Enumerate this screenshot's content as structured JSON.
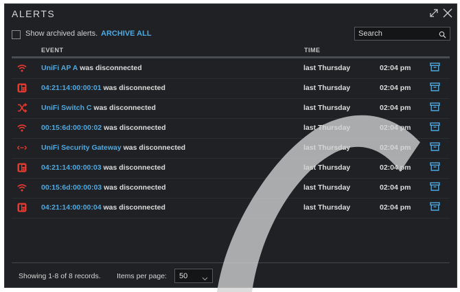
{
  "window": {
    "title": "ALERTS"
  },
  "toolbar": {
    "show_archived_label": "Show archived alerts.",
    "archive_all_label": "ARCHIVE ALL",
    "search_placeholder": "Search"
  },
  "columns": {
    "event": "EVENT",
    "time": "TIME"
  },
  "alerts": [
    {
      "icon": "wifi-icon",
      "device": "UniFi AP A",
      "text": "was disconnected",
      "day": "last Thursday",
      "time": "02:04 pm"
    },
    {
      "icon": "phone-icon",
      "device": "04:21:14:00:00:01",
      "text": "was disconnected",
      "day": "last Thursday",
      "time": "02:04 pm"
    },
    {
      "icon": "switch-icon",
      "device": "UniFi Switch C",
      "text": "was disconnected",
      "day": "last Thursday",
      "time": "02:04 pm"
    },
    {
      "icon": "wifi-icon",
      "device": "00:15:6d:00:00:02",
      "text": "was disconnected",
      "day": "last Thursday",
      "time": "02:04 pm"
    },
    {
      "icon": "gateway-icon",
      "device": "UniFi Security Gateway",
      "text": "was disconnected",
      "day": "last Thursday",
      "time": "02:04 pm"
    },
    {
      "icon": "phone-icon",
      "device": "04:21:14:00:00:03",
      "text": "was disconnected",
      "day": "last Thursday",
      "time": "02:04 pm"
    },
    {
      "icon": "wifi-icon",
      "device": "00:15:6d:00:00:03",
      "text": "was disconnected",
      "day": "last Thursday",
      "time": "02:04 pm"
    },
    {
      "icon": "phone-icon",
      "device": "04:21:14:00:00:04",
      "text": "was disconnected",
      "day": "last Thursday",
      "time": "02:04 pm"
    }
  ],
  "footer": {
    "showing_text": "Showing 1-8 of 8 records.",
    "items_per_page_label": "Items per page:",
    "items_per_page_value": "50"
  },
  "colors": {
    "accent": "#4fa9e1",
    "alert": "#e8392f",
    "panel": "#1f2124"
  }
}
